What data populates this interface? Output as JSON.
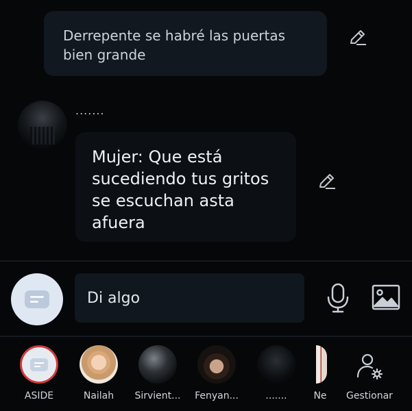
{
  "messages": {
    "user_message": "Derrepente se habré las puertas bien grande",
    "character_name": ".......",
    "character_message": "Mujer: Que está sucediendo tus gritos se escuchan asta afuera"
  },
  "composer": {
    "placeholder": "Di algo"
  },
  "tabs": [
    {
      "label": "ASIDE"
    },
    {
      "label": "Nailah"
    },
    {
      "label": "Sirvient..."
    },
    {
      "label": "Fenyan..."
    },
    {
      "label": "......."
    },
    {
      "label": "Ne"
    },
    {
      "label": "Gestionar"
    }
  ],
  "colors": {
    "background": "#050709",
    "bubble": "#121820",
    "aside_ring": "#d23a3a"
  }
}
